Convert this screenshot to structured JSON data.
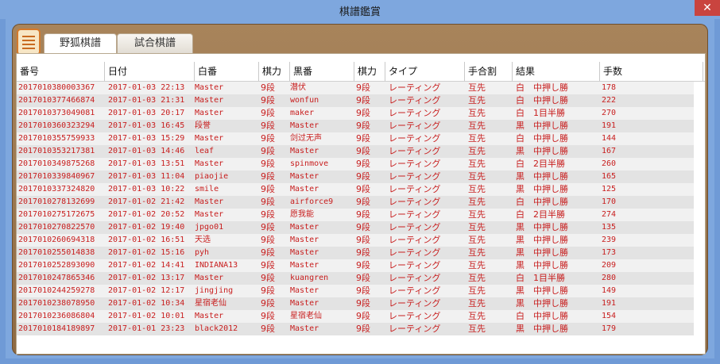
{
  "window": {
    "title": "棋譜鑑賞",
    "close_label": "✕"
  },
  "tabs": [
    {
      "label": "野狐棋譜",
      "active": true
    },
    {
      "label": "試合棋譜",
      "active": false
    }
  ],
  "table": {
    "columns": [
      "番号",
      "日付",
      "白番",
      "棋力",
      "黒番",
      "棋力",
      "タイプ",
      "手合割",
      "結果",
      "手数"
    ],
    "rows": [
      [
        "2017010380003367",
        "2017-01-03 22:13",
        "Master",
        "9段",
        "潜伏",
        "9段",
        "レーティング",
        "互先",
        "白　中押し勝",
        "178"
      ],
      [
        "2017010377466874",
        "2017-01-03 21:31",
        "Master",
        "9段",
        "wonfun",
        "9段",
        "レーティング",
        "互先",
        "白　中押し勝",
        "222"
      ],
      [
        "2017010373049081",
        "2017-01-03 20:17",
        "Master",
        "9段",
        "maker",
        "9段",
        "レーティング",
        "互先",
        "白　1目半勝",
        "270"
      ],
      [
        "2017010360323294",
        "2017-01-03 16:45",
        "段誉",
        "9段",
        "Master",
        "9段",
        "レーティング",
        "互先",
        "黒　中押し勝",
        "191"
      ],
      [
        "2017010355759933",
        "2017-01-03 15:29",
        "Master",
        "9段",
        "剑过无声",
        "9段",
        "レーティング",
        "互先",
        "白　中押し勝",
        "144"
      ],
      [
        "2017010353217381",
        "2017-01-03 14:46",
        "leaf",
        "9段",
        "Master",
        "9段",
        "レーティング",
        "互先",
        "黒　中押し勝",
        "167"
      ],
      [
        "2017010349875268",
        "2017-01-03 13:51",
        "Master",
        "9段",
        "spinmove",
        "9段",
        "レーティング",
        "互先",
        "白　2目半勝",
        "260"
      ],
      [
        "2017010339840967",
        "2017-01-03 11:04",
        "piaojie",
        "9段",
        "Master",
        "9段",
        "レーティング",
        "互先",
        "黒　中押し勝",
        "165"
      ],
      [
        "2017010337324820",
        "2017-01-03 10:22",
        "smile",
        "9段",
        "Master",
        "9段",
        "レーティング",
        "互先",
        "黒　中押し勝",
        "125"
      ],
      [
        "2017010278132699",
        "2017-01-02 21:42",
        "Master",
        "9段",
        "airforce9",
        "9段",
        "レーティング",
        "互先",
        "白　中押し勝",
        "170"
      ],
      [
        "2017010275172675",
        "2017-01-02 20:52",
        "Master",
        "9段",
        "愿我能",
        "9段",
        "レーティング",
        "互先",
        "白　2目半勝",
        "274"
      ],
      [
        "2017010270822570",
        "2017-01-02 19:40",
        "jpgo01",
        "9段",
        "Master",
        "9段",
        "レーティング",
        "互先",
        "黒　中押し勝",
        "135"
      ],
      [
        "2017010260694318",
        "2017-01-02 16:51",
        "天选",
        "9段",
        "Master",
        "9段",
        "レーティング",
        "互先",
        "黒　中押し勝",
        "239"
      ],
      [
        "2017010255014838",
        "2017-01-02 15:16",
        "pyh",
        "9段",
        "Master",
        "9段",
        "レーティング",
        "互先",
        "黒　中押し勝",
        "173"
      ],
      [
        "2017010252893090",
        "2017-01-02 14:41",
        "INDIANA13",
        "9段",
        "Master",
        "9段",
        "レーティング",
        "互先",
        "黒　中押し勝",
        "209"
      ],
      [
        "2017010247865346",
        "2017-01-02 13:17",
        "Master",
        "9段",
        "kuangren",
        "9段",
        "レーティング",
        "互先",
        "白　1目半勝",
        "280"
      ],
      [
        "2017010244259278",
        "2017-01-02 12:17",
        "jingjing",
        "9段",
        "Master",
        "9段",
        "レーティング",
        "互先",
        "黒　中押し勝",
        "149"
      ],
      [
        "2017010238078950",
        "2017-01-02 10:34",
        "星宿老仙",
        "9段",
        "Master",
        "9段",
        "レーティング",
        "互先",
        "黒　中押し勝",
        "191"
      ],
      [
        "2017010236086804",
        "2017-01-02 10:01",
        "Master",
        "9段",
        "星宿老仙",
        "9段",
        "レーティング",
        "互先",
        "白　中押し勝",
        "154"
      ],
      [
        "2017010184189897",
        "2017-01-01 23:23",
        "black2012",
        "9段",
        "Master",
        "9段",
        "レーティング",
        "互先",
        "黒　中押し勝",
        "179"
      ]
    ]
  },
  "colors": {
    "row_text": "#c81e1e",
    "accent": "#d4792c",
    "panel": "#8e6a43"
  },
  "icons": {
    "menu": "menu-list-icon",
    "close": "close-icon"
  }
}
